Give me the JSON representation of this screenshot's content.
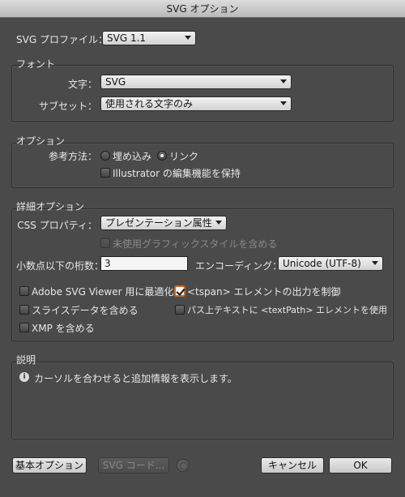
{
  "window": {
    "title": "SVG オプション"
  },
  "profile": {
    "label": "SVG プロファイル：",
    "value": "SVG 1.1"
  },
  "font": {
    "title": "フォント",
    "type_label": "文字：",
    "type_value": "SVG",
    "subset_label": "サブセット：",
    "subset_value": "使用される文字のみ"
  },
  "options": {
    "title": "オプション",
    "ref_label": "参考方法：",
    "embed_label": "埋め込み",
    "link_label": "リンク",
    "preserve_label": "Illustrator の編集機能を保持"
  },
  "advanced": {
    "title": "詳細オプション",
    "css_label": "CSS プロパティ：",
    "css_value": "プレゼンテーション属性",
    "unused_styles_label": "未使用グラフィックスタイルを含める",
    "decimal_label": "小数点以下の桁数：",
    "decimal_value": "3",
    "encoding_label": "エンコーディング：",
    "encoding_value": "Unicode (UTF-8)",
    "optimize_label": "Adobe SVG Viewer 用に最適化",
    "tspan_label": "<tspan> エレメントの出力を制御",
    "slice_label": "スライスデータを含める",
    "textpath_label": "パス上テキストに <textPath> エレメントを使用",
    "xmp_label": "XMP を含める"
  },
  "description": {
    "title": "説明",
    "text": "カーソルを合わせると追加情報を表示します。"
  },
  "buttons": {
    "basic": "基本オプション",
    "svg_code": "SVG コード...",
    "cancel": "キャンセル",
    "ok": "OK"
  },
  "state": {
    "embed_selected": false,
    "link_selected": true,
    "preserve_checked": false,
    "unused_styles_checked": false,
    "optimize_checked": false,
    "tspan_checked": true,
    "slice_checked": false,
    "textpath_checked": false,
    "xmp_checked": false
  }
}
